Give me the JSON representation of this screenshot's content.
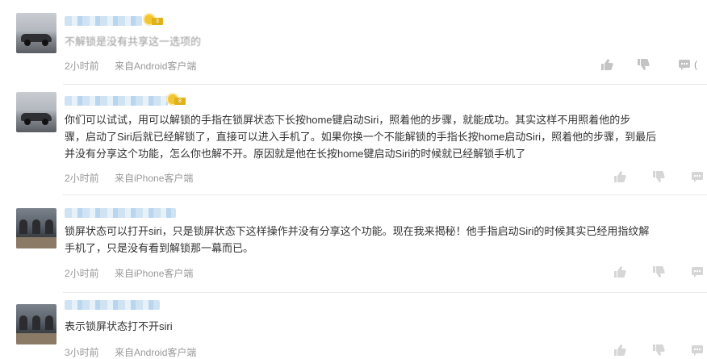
{
  "comments": [
    {
      "text_lines": [
        "不解锁是没有共享这一选项的"
      ],
      "time": "2小时前",
      "source": "来自Android客户端",
      "level": "3",
      "reply_count": "("
    },
    {
      "text_lines": [
        "你们可以试试，用可以解锁的手指在锁屏状态下长按home键启动Siri，照着他的步骤，就能成功。其实这样不用照着他的步",
        "骤，启动了Siri后就已经解锁了，直接可以进入手机了。如果你换一个不能解锁的手指长按home启动Siri，照着他的步骤，到最后",
        "并没有分享这个功能，怎么你也解不开。原因就是他在长按home键启动Siri的时候就已经解锁手机了"
      ],
      "time": "2小时前",
      "source": "来自iPhone客户端",
      "level": "8"
    },
    {
      "text_lines": [
        "锁屏状态可以打开siri，只是锁屏状态下这样操作并没有分享这个功能。现在我来揭秘！他手指启动Siri的时候其实已经用指纹解",
        "手机了，只是没有看到解锁那一幕而已。"
      ],
      "time": "2小时前",
      "source": "来自iPhone客户端"
    },
    {
      "text_lines": [
        "表示锁屏状态打不开siri"
      ],
      "time": "3小时前",
      "source": "来自Android客户端"
    }
  ],
  "icons": {
    "like": "thumbs-up-icon",
    "dislike": "thumbs-down-icon",
    "reply": "comment-bubble-icon"
  }
}
